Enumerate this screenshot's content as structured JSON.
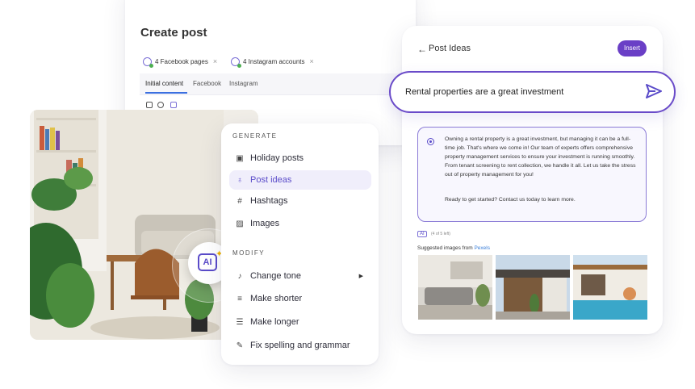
{
  "create_post": {
    "title": "Create post",
    "chips": [
      {
        "label": "4 Facebook pages",
        "close": "×"
      },
      {
        "label": "4 Instagram accounts",
        "close": "×"
      }
    ],
    "tabs": [
      "Initial content",
      "Facebook",
      "Instagram"
    ]
  },
  "menu": {
    "generate_title": "GENERATE",
    "generate_items": [
      {
        "label": "Holiday posts",
        "icon": "calendar-icon"
      },
      {
        "label": "Post ideas",
        "icon": "lightbulb-icon"
      },
      {
        "label": "Hashtags",
        "icon": "hashtag-icon"
      },
      {
        "label": "Images",
        "icon": "image-icon"
      }
    ],
    "modify_title": "MODIFY",
    "modify_items": [
      {
        "label": "Change tone",
        "icon": "tone-icon"
      },
      {
        "label": "Make shorter",
        "icon": "shorten-icon"
      },
      {
        "label": "Make longer",
        "icon": "lengthen-icon"
      },
      {
        "label": "Fix spelling and grammar",
        "icon": "spellcheck-icon"
      }
    ],
    "active_item": "Post ideas"
  },
  "ai_badge": {
    "label": "AI"
  },
  "post_ideas": {
    "back": "←",
    "title": "Post Ideas",
    "insert_label": "Insert",
    "prompt": "Rental properties are a great investment",
    "answer": "Owning a rental property is a great investment, but managing it can be a full-time job. That's where we come in! Our team of experts offers comprehensive property management services to ensure your investment is running smoothly. From tenant screening to rent collection, we handle it all. Let us take the stress out of property management for you!",
    "answer_cta": "Ready to get started? Contact us today to learn more.",
    "ai_tag": "AI",
    "count": "(4 of 5 left)",
    "suggested_prefix": "Suggested images from ",
    "suggested_source": "Pexels"
  },
  "colors": {
    "accent": "#5a4bc9",
    "insert": "#6a3fc6",
    "link": "#3b7fd9"
  }
}
